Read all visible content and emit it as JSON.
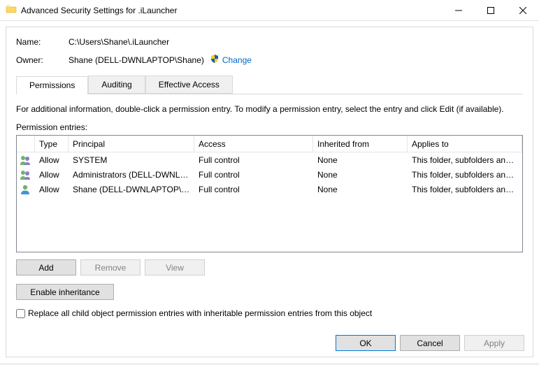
{
  "window": {
    "title": "Advanced Security Settings for .iLauncher"
  },
  "meta": {
    "name_label": "Name:",
    "name_value": "C:\\Users\\Shane\\.iLauncher",
    "owner_label": "Owner:",
    "owner_value": "Shane (DELL-DWNLAPTOP\\Shane)",
    "change_link": "Change"
  },
  "tabs": {
    "permissions": "Permissions",
    "auditing": "Auditing",
    "effective": "Effective Access"
  },
  "info_text": "For additional information, double-click a permission entry. To modify a permission entry, select the entry and click Edit (if available).",
  "entries_label": "Permission entries:",
  "columns": {
    "type": "Type",
    "principal": "Principal",
    "access": "Access",
    "inherited": "Inherited from",
    "applies": "Applies to"
  },
  "rows": [
    {
      "icon": "group",
      "type": "Allow",
      "principal": "SYSTEM",
      "access": "Full control",
      "inherited": "None",
      "applies": "This folder, subfolders and files"
    },
    {
      "icon": "group",
      "type": "Allow",
      "principal": "Administrators (DELL-DWNLA...",
      "access": "Full control",
      "inherited": "None",
      "applies": "This folder, subfolders and files"
    },
    {
      "icon": "user",
      "type": "Allow",
      "principal": "Shane (DELL-DWNLAPTOP\\Sh...",
      "access": "Full control",
      "inherited": "None",
      "applies": "This folder, subfolders and files"
    }
  ],
  "buttons": {
    "add": "Add",
    "remove": "Remove",
    "view": "View",
    "enable_inheritance": "Enable inheritance",
    "ok": "OK",
    "cancel": "Cancel",
    "apply": "Apply"
  },
  "checkbox_label": "Replace all child object permission entries with inheritable permission entries from this object"
}
